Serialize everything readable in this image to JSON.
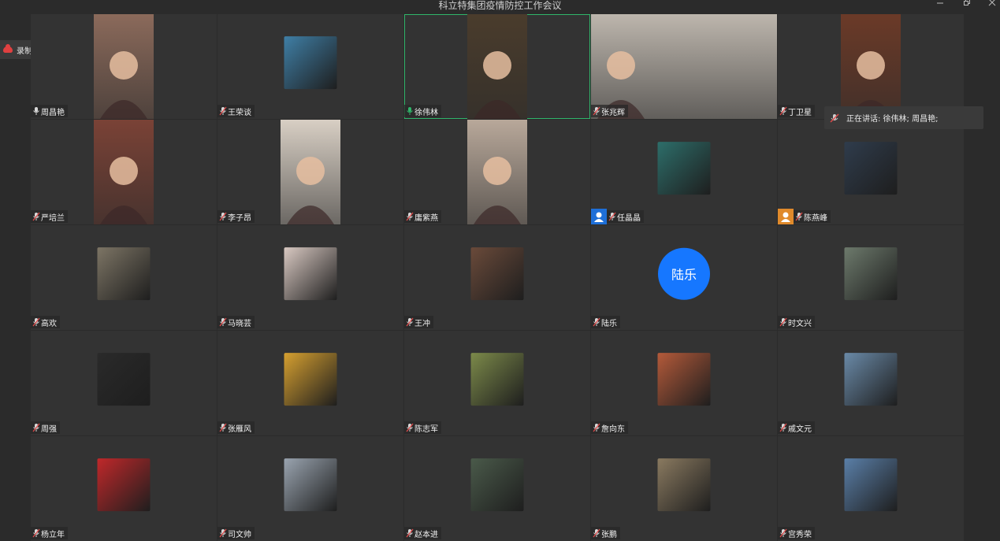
{
  "window": {
    "title": "科立特集团疫情防控工作会议"
  },
  "recording": {
    "label": "录制中"
  },
  "speaking": {
    "text": "正在讲话: 徐伟林; 周昌艳;"
  },
  "colors": {
    "accent_blue": "#1677ff",
    "active_border": "#2fb56a",
    "avatar_blue": "#1e6fd8",
    "avatar_orange": "#e08a2b",
    "mic_muted": "#e04a4a",
    "mic_active": "#2fb56a"
  },
  "participants": [
    {
      "name": "周昌艳",
      "mic": "on",
      "kind": "video",
      "bg": "#8b6a5b"
    },
    {
      "name": "王荣谈",
      "mic": "muted",
      "kind": "thumb",
      "bg": "#3f7fa6"
    },
    {
      "name": "徐伟林",
      "mic": "speaking",
      "kind": "video",
      "bg": "#4a3c2c"
    },
    {
      "name": "张兆辉",
      "mic": "muted",
      "kind": "video",
      "bg": "#bdb6ad"
    },
    {
      "name": "丁卫星",
      "mic": "muted",
      "kind": "video",
      "bg": "#6b3a28"
    },
    {
      "name": "严培兰",
      "mic": "muted",
      "kind": "video",
      "bg": "#7a4236"
    },
    {
      "name": "李子昂",
      "mic": "muted",
      "kind": "video",
      "bg": "#d8cfc4"
    },
    {
      "name": "庸紫燕",
      "mic": "muted",
      "kind": "video",
      "bg": "#b8a89a"
    },
    {
      "name": "任晶晶",
      "mic": "muted",
      "kind": "thumb",
      "bg": "#2d6e6a",
      "badge": "blue"
    },
    {
      "name": "陈燕峰",
      "mic": "muted",
      "kind": "thumb",
      "bg": "#2f3c4c",
      "badge": "orange"
    },
    {
      "name": "高欢",
      "mic": "muted",
      "kind": "thumb",
      "bg": "#7d7565"
    },
    {
      "name": "马晓芸",
      "mic": "muted",
      "kind": "thumb",
      "bg": "#d9c9c2"
    },
    {
      "name": "王冲",
      "mic": "muted",
      "kind": "thumb",
      "bg": "#6a4a3a"
    },
    {
      "name": "陆乐",
      "mic": "muted",
      "kind": "circle",
      "initials": "陆乐"
    },
    {
      "name": "时文兴",
      "mic": "muted",
      "kind": "thumb",
      "bg": "#6d7a6c"
    },
    {
      "name": "周强",
      "mic": "muted",
      "kind": "thumb",
      "bg": "#2a2a2a"
    },
    {
      "name": "张雁风",
      "mic": "muted",
      "kind": "thumb",
      "bg": "#d6a030"
    },
    {
      "name": "陈志军",
      "mic": "muted",
      "kind": "thumb",
      "bg": "#7c8a4a"
    },
    {
      "name": "詹向东",
      "mic": "muted",
      "kind": "thumb",
      "bg": "#b45a3a"
    },
    {
      "name": "戚文元",
      "mic": "muted",
      "kind": "thumb",
      "bg": "#6a8aa8"
    },
    {
      "name": "杨立年",
      "mic": "muted",
      "kind": "thumb",
      "bg": "#c0282a"
    },
    {
      "name": "司文帅",
      "mic": "muted",
      "kind": "thumb",
      "bg": "#9aa4b0"
    },
    {
      "name": "赵本进",
      "mic": "muted",
      "kind": "thumb",
      "bg": "#4a5a4a"
    },
    {
      "name": "张鹏",
      "mic": "muted",
      "kind": "thumb",
      "bg": "#8a7a60"
    },
    {
      "name": "宫秀荣",
      "mic": "muted",
      "kind": "thumb",
      "bg": "#5a7fa8"
    }
  ]
}
